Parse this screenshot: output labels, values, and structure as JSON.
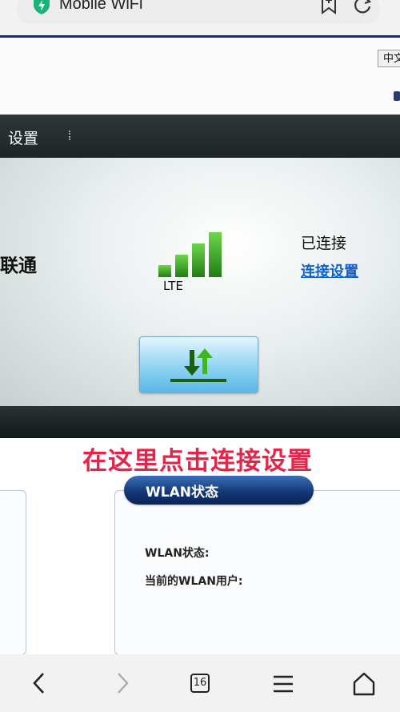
{
  "browser": {
    "url_title": "Mobile WiFi",
    "tab_count": "16"
  },
  "header": {
    "language_button": "中文",
    "nav_title": "设置"
  },
  "status_panel": {
    "operator": "联通",
    "network_type": "LTE",
    "signal_bars": 4,
    "signal_bars_max": 5,
    "connection_status": "已连接",
    "connection_settings_link": "连接设置"
  },
  "overlay": {
    "instruction": "在这里点击连接设置"
  },
  "wlan": {
    "tab_title": "WLAN状态",
    "status_label": "WLAN状态:",
    "users_label": "当前的WLAN用户:"
  },
  "colors": {
    "accent_blue": "#123574",
    "signal_green": "#2f9a1f",
    "overlay_red": "#e2264a",
    "link_blue": "#1060c8"
  }
}
